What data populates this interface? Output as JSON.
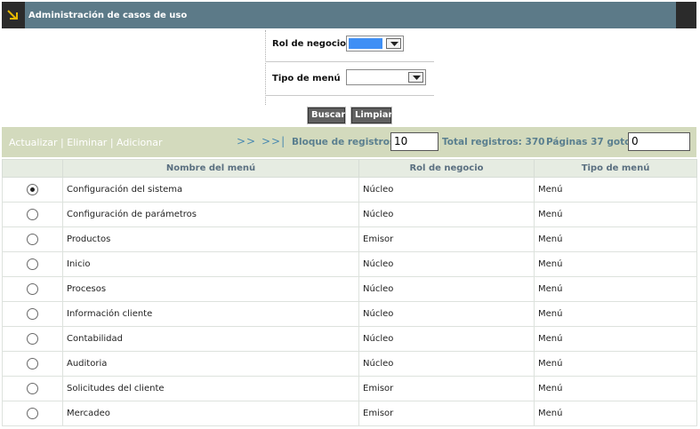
{
  "window": {
    "title": "Administración de casos de uso"
  },
  "filters": {
    "rol_label": "Rol de negocio",
    "rol_value": "",
    "tipo_label": "Tipo de menú",
    "tipo_value": ""
  },
  "buttons": {
    "buscar": "Buscar",
    "limpiar": "Limpiar"
  },
  "toolbar": {
    "actualizar": "Actualizar",
    "eliminar": "Eliminar",
    "adicionar": "Adicionar",
    "separator": " | ",
    "next": ">>",
    "last": ">>|",
    "bloque_label": "Bloque de registros:",
    "bloque_value": "10",
    "total_label": "Total registros: 370",
    "paginas_label": "Páginas 37 goto:",
    "goto_value": "0"
  },
  "table": {
    "headers": [
      "",
      "Nombre del menú",
      "Rol de negocio",
      "Tipo de menú"
    ],
    "rows": [
      {
        "selected": true,
        "nombre": "Configuración del sistema",
        "rol": "Núcleo",
        "tipo": "Menú"
      },
      {
        "selected": false,
        "nombre": "Configuración de parámetros",
        "rol": "Núcleo",
        "tipo": "Menú"
      },
      {
        "selected": false,
        "nombre": "Productos",
        "rol": "Emisor",
        "tipo": "Menú"
      },
      {
        "selected": false,
        "nombre": "Inicio",
        "rol": "Núcleo",
        "tipo": "Menú"
      },
      {
        "selected": false,
        "nombre": "Procesos",
        "rol": "Núcleo",
        "tipo": "Menú"
      },
      {
        "selected": false,
        "nombre": "Información cliente",
        "rol": "Núcleo",
        "tipo": "Menú"
      },
      {
        "selected": false,
        "nombre": "Contabilidad",
        "rol": "Núcleo",
        "tipo": "Menú"
      },
      {
        "selected": false,
        "nombre": "Auditoria",
        "rol": "Núcleo",
        "tipo": "Menú"
      },
      {
        "selected": false,
        "nombre": "Solicitudes del cliente",
        "rol": "Emisor",
        "tipo": "Menú"
      },
      {
        "selected": false,
        "nombre": "Mercadeo",
        "rol": "Emisor",
        "tipo": "Menú"
      }
    ]
  },
  "colors": {
    "titlebar": "#5c7a88",
    "toolbar": "#d3dabd",
    "header_row": "#e6ece2",
    "link": "#ffffff",
    "nav": "#4a8ab0",
    "selected_fill": "#3f8ff5"
  },
  "icons": {
    "app_logo": "arrow-corner-icon",
    "dropdown": "chevron-down-icon"
  }
}
